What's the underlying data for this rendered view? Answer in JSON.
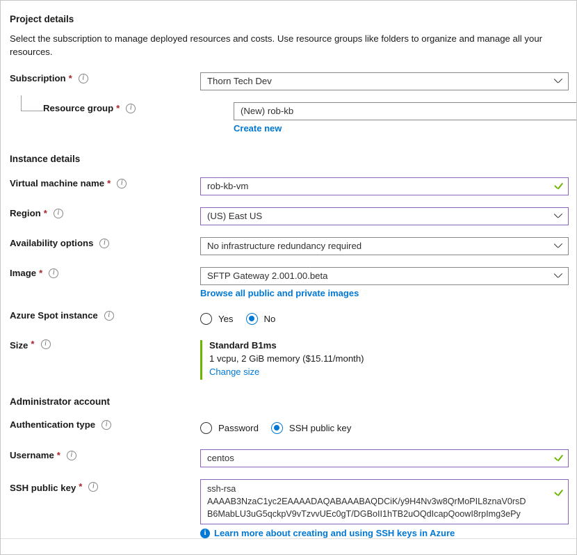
{
  "project": {
    "heading": "Project details",
    "description": "Select the subscription to manage deployed resources and costs. Use resource groups like folders to organize and manage all your resources.",
    "subscription": {
      "label": "Subscription",
      "required": "*",
      "value": "Thorn Tech Dev"
    },
    "resource_group": {
      "label": "Resource group",
      "required": "*",
      "value": "(New) rob-kb",
      "create_new_link": "Create new"
    }
  },
  "instance": {
    "heading": "Instance details",
    "vm_name": {
      "label": "Virtual machine name",
      "required": "*",
      "value": "rob-kb-vm"
    },
    "region": {
      "label": "Region",
      "required": "*",
      "value": "(US) East US"
    },
    "availability": {
      "label": "Availability options",
      "value": "No infrastructure redundancy required"
    },
    "image": {
      "label": "Image",
      "required": "*",
      "value": "SFTP Gateway 2.001.00.beta",
      "browse_link": "Browse all public and private images"
    },
    "spot": {
      "label": "Azure Spot instance",
      "options": [
        {
          "label": "Yes",
          "checked": false
        },
        {
          "label": "No",
          "checked": true
        }
      ]
    },
    "size": {
      "label": "Size",
      "required": "*",
      "name": "Standard B1ms",
      "detail": "1 vcpu, 2 GiB memory ($15.11/month)",
      "change_link": "Change size"
    }
  },
  "administrator": {
    "heading": "Administrator account",
    "auth_type": {
      "label": "Authentication type",
      "options": [
        {
          "label": "Password",
          "checked": false
        },
        {
          "label": "SSH public key",
          "checked": true
        }
      ]
    },
    "username": {
      "label": "Username",
      "required": "*",
      "value": "centos"
    },
    "ssh_key": {
      "label": "SSH public key",
      "required": "*",
      "line1": "ssh-rsa",
      "line2": "AAAAB3NzaC1yc2EAAAADAQABAAABAQDCiK/y9H4Nv3w8QrMoPIL8znaV0rsD",
      "line3": "B6MabLU3uG5qckpV9vTzvvUEc0gT/DGBoII1hTB2uOQdIcapQoowI8rpImg3ePy",
      "learn_more": "Learn more about creating and using SSH keys in Azure"
    }
  },
  "icons": {
    "info": "i",
    "info_badge": "i"
  },
  "colors": {
    "accent_link": "#0078d4",
    "validated_border": "#8764b8",
    "success_green": "#6bb700",
    "required_red": "#a4262c",
    "default_border": "#8a8886"
  }
}
